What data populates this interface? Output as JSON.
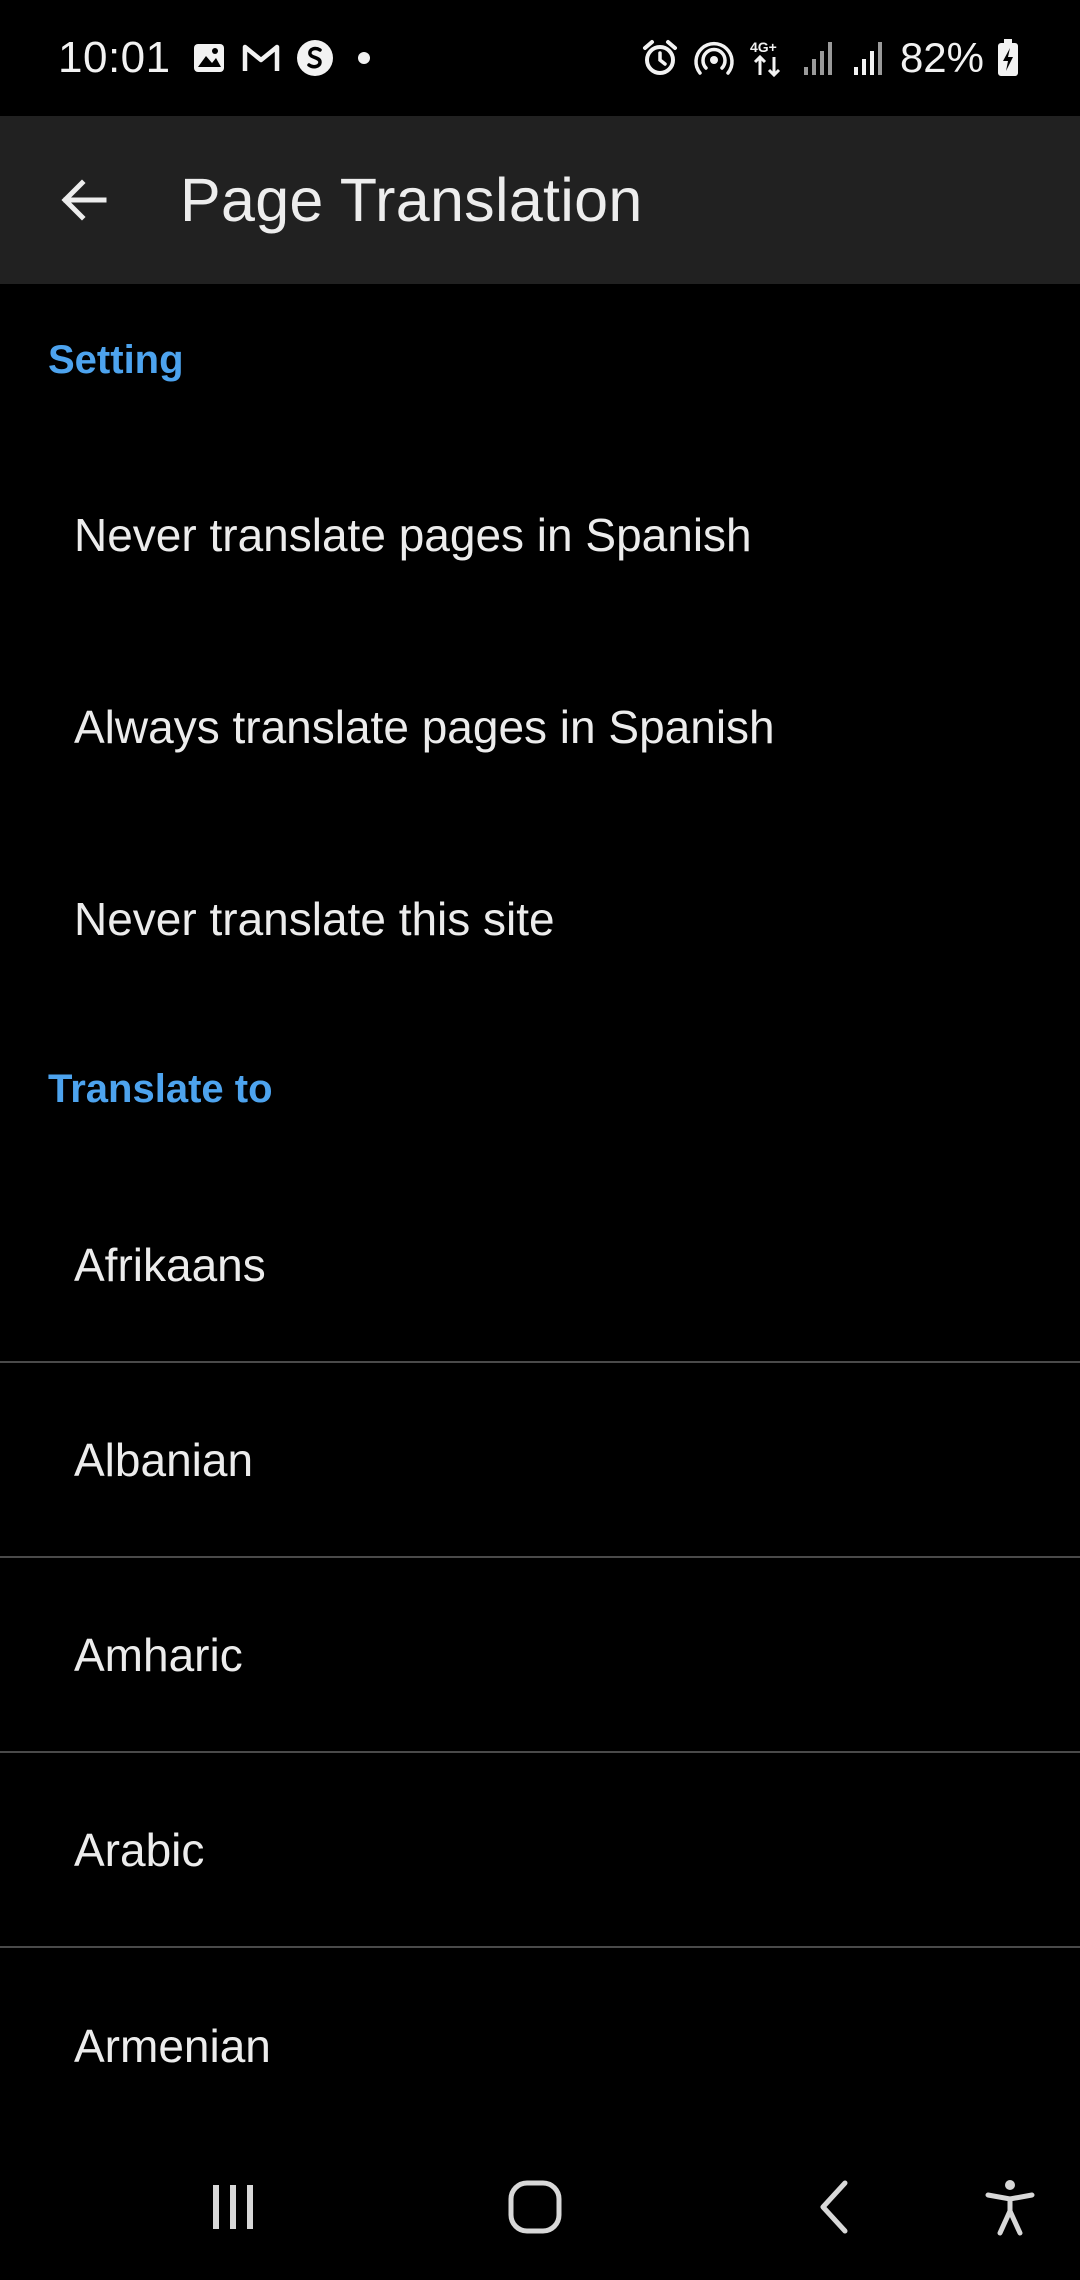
{
  "status_bar": {
    "time": "10:01",
    "left_icons": [
      "image-icon",
      "gmail-icon",
      "shazam-icon",
      "dot-icon"
    ],
    "right_icons": [
      "alarm-icon",
      "hotspot-icon",
      "network-4g-icon",
      "signal-icon",
      "signal-icon"
    ],
    "battery_text": "82%",
    "battery_level": 0.82
  },
  "app_bar": {
    "back_icon": "arrow-left-icon",
    "title": "Page Translation"
  },
  "sections": {
    "setting_header": "Setting",
    "settings": [
      "Never translate pages in Spanish",
      "Always translate pages in Spanish",
      "Never translate this site"
    ],
    "translate_to_header": "Translate to",
    "languages": [
      "Afrikaans",
      "Albanian",
      "Amharic",
      "Arabic",
      "Armenian"
    ]
  },
  "nav_bar": {
    "buttons": [
      "recents-icon",
      "home-icon",
      "back-icon",
      "accessibility-icon"
    ]
  },
  "colors": {
    "background": "#000000",
    "app_bar": "#212121",
    "accent": "#4da3ee",
    "text": "#ececec",
    "divider": "#4a4a4a"
  }
}
